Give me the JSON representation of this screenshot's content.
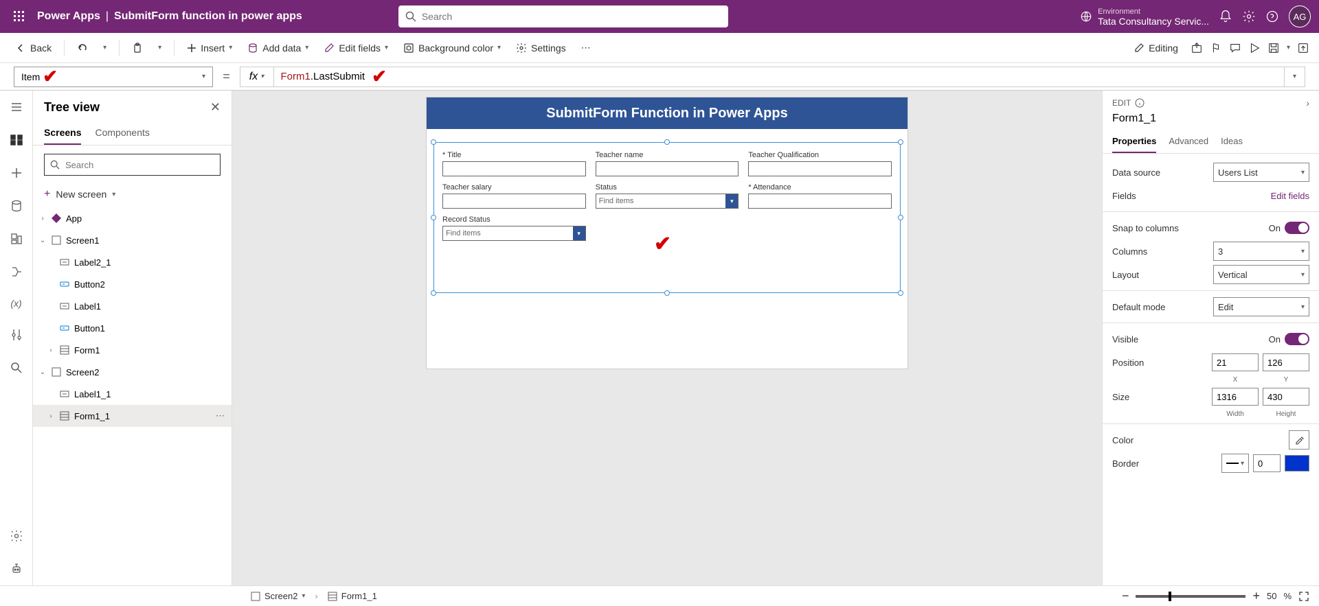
{
  "header": {
    "app_name": "Power Apps",
    "doc_title": "SubmitForm function in power apps",
    "search_placeholder": "Search",
    "env_label": "Environment",
    "env_value": "Tata Consultancy Servic...",
    "avatar_initials": "AG"
  },
  "cmdbar": {
    "back": "Back",
    "insert": "Insert",
    "add_data": "Add data",
    "edit_fields": "Edit fields",
    "bg_color": "Background color",
    "settings": "Settings",
    "editing": "Editing"
  },
  "formula": {
    "property": "Item",
    "fx": "fx",
    "expr_obj": "Form1",
    "expr_rest": ".LastSubmit"
  },
  "tree": {
    "title": "Tree view",
    "tab_screens": "Screens",
    "tab_components": "Components",
    "search_placeholder": "Search",
    "new_screen": "New screen",
    "items": {
      "app": "App",
      "screen1": "Screen1",
      "label2_1": "Label2_1",
      "button2": "Button2",
      "label1": "Label1",
      "button1": "Button1",
      "form1": "Form1",
      "screen2": "Screen2",
      "label1_1": "Label1_1",
      "form1_1": "Form1_1"
    }
  },
  "canvas": {
    "header": "SubmitForm Function in Power Apps",
    "fields": {
      "title": "Title",
      "teacher_name": "Teacher name",
      "teacher_qual": "Teacher Qualification",
      "teacher_salary": "Teacher salary",
      "status": "Status",
      "attendance": "Attendance",
      "record_status": "Record Status",
      "find_items": "Find items"
    }
  },
  "props": {
    "edit": "EDIT",
    "name": "Form1_1",
    "tab_properties": "Properties",
    "tab_advanced": "Advanced",
    "tab_ideas": "Ideas",
    "data_source": "Data source",
    "data_source_val": "Users List",
    "fields": "Fields",
    "edit_fields": "Edit fields",
    "snap": "Snap to columns",
    "on": "On",
    "columns": "Columns",
    "columns_val": "3",
    "layout": "Layout",
    "layout_val": "Vertical",
    "default_mode": "Default mode",
    "default_mode_val": "Edit",
    "visible": "Visible",
    "position": "Position",
    "pos_x": "21",
    "pos_y": "126",
    "x": "X",
    "y": "Y",
    "size": "Size",
    "width": "1316",
    "height": "430",
    "w": "Width",
    "h": "Height",
    "color": "Color",
    "border": "Border",
    "border_val": "0"
  },
  "bottom": {
    "screen2": "Screen2",
    "form1_1": "Form1_1",
    "zoom": "50",
    "pct": "%"
  }
}
